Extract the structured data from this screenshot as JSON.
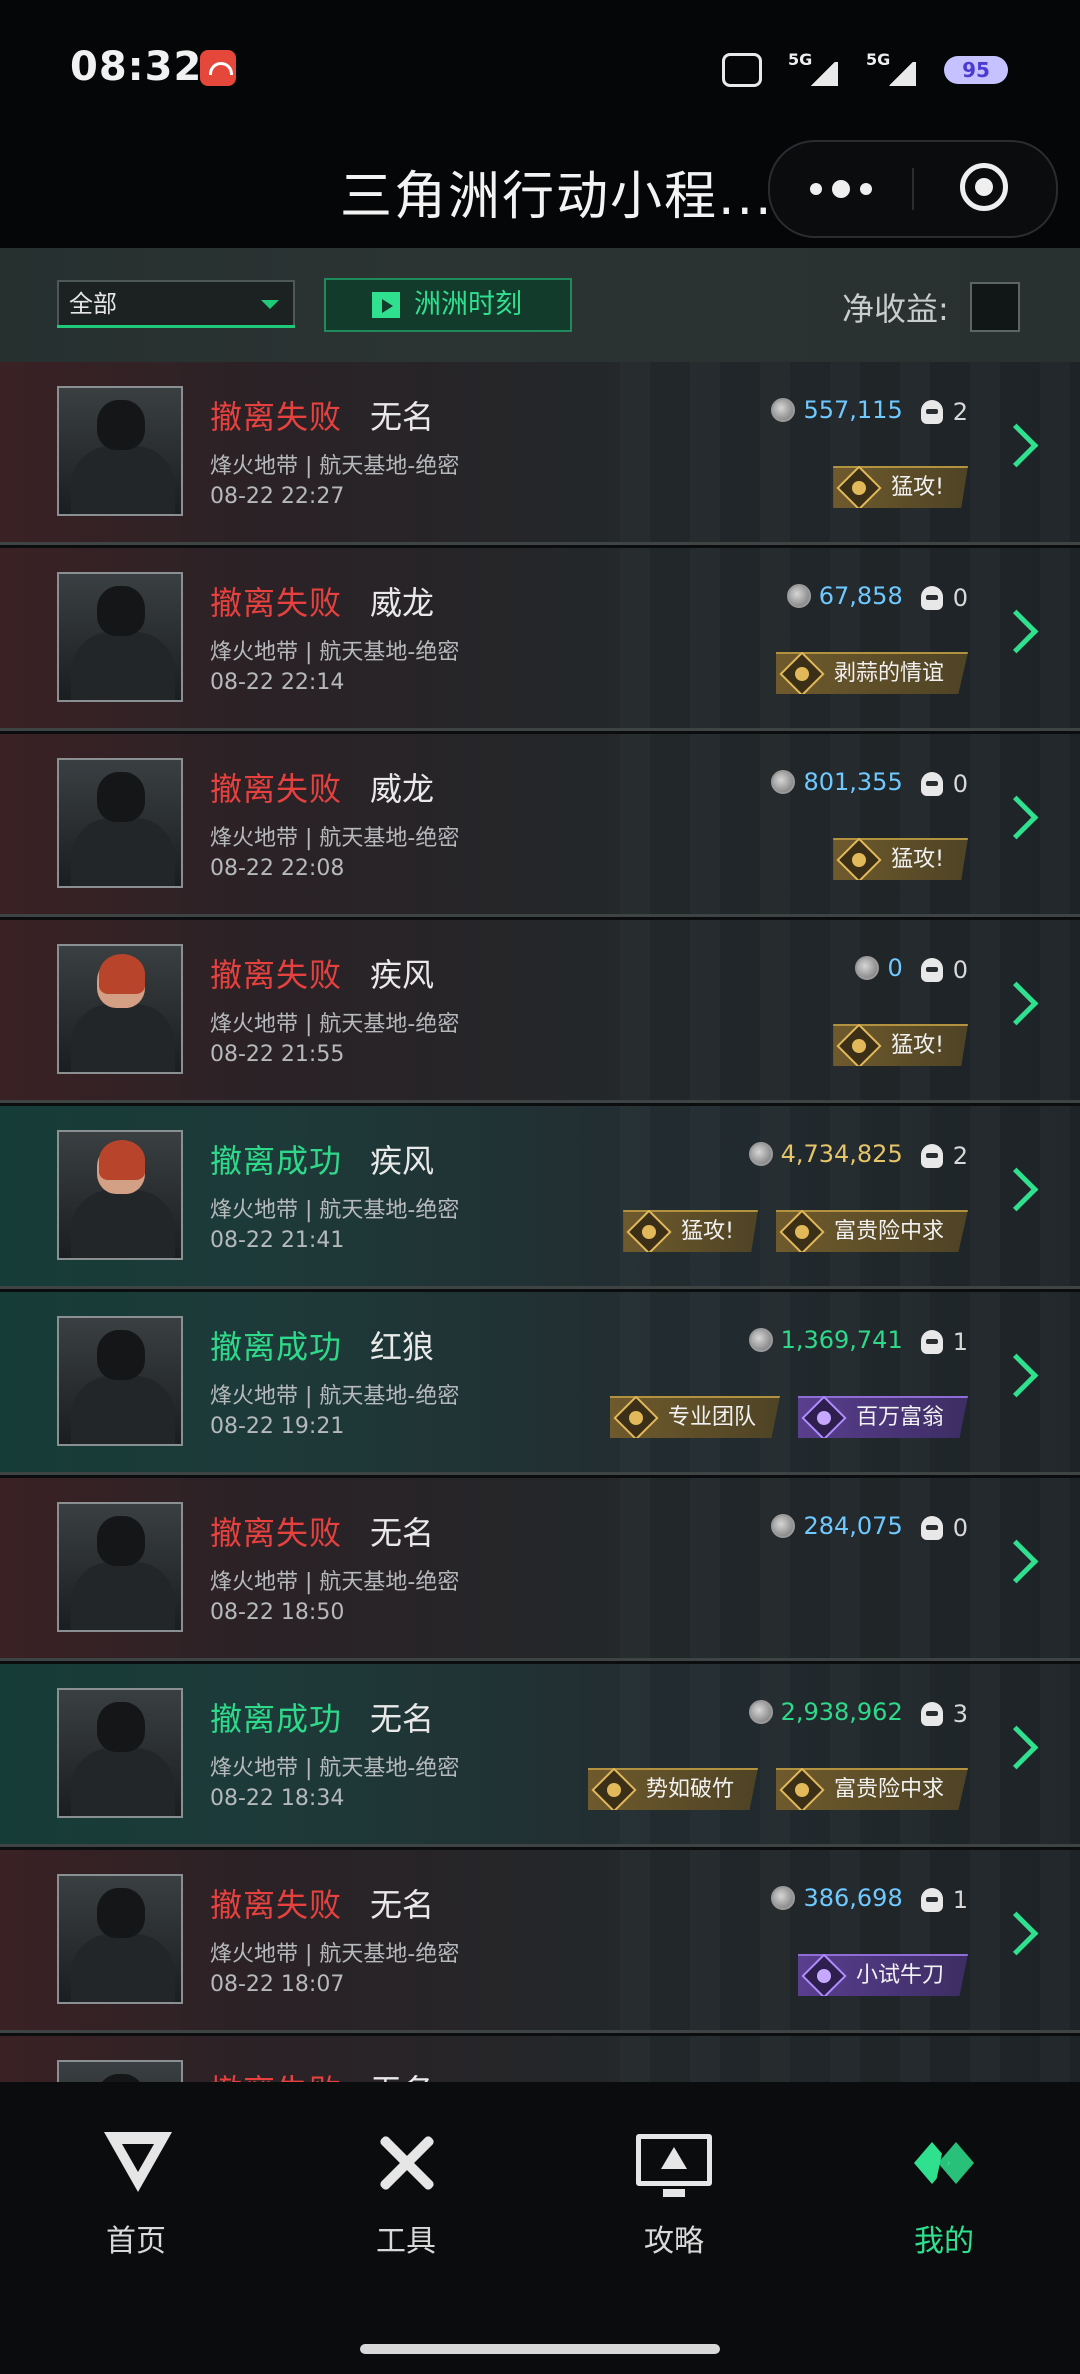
{
  "status_bar": {
    "time": "08:32",
    "network_1": "5G",
    "network_2": "5G",
    "battery": "95"
  },
  "header": {
    "title": "三角洲行动小程..."
  },
  "filter_bar": {
    "select_value": "全部",
    "moment_button": "洲洲时刻",
    "net_income_label": "净收益:"
  },
  "colors": {
    "accent_green": "#2fe08e",
    "fail_red": "#e6413f",
    "value_blue": "#6fc9ff",
    "value_gold": "#e6c46a"
  },
  "records": [
    {
      "status": "撤离失败",
      "result": "fail",
      "operator": "无名",
      "map": "烽火地带 | 航天基地-绝密",
      "datetime": "08-22 22:27",
      "value": "557,115",
      "kills": "2",
      "avatar": "masked-soldier",
      "badges": [
        {
          "label": "猛攻!",
          "tier": "gold"
        }
      ]
    },
    {
      "status": "撤离失败",
      "result": "fail",
      "operator": "威龙",
      "map": "烽火地带 | 航天基地-绝密",
      "datetime": "08-22 22:14",
      "value": "67,858",
      "kills": "0",
      "avatar": "armored-soldier",
      "badges": [
        {
          "label": "剥蒜的情谊",
          "tier": "gold"
        }
      ]
    },
    {
      "status": "撤离失败",
      "result": "fail",
      "operator": "威龙",
      "map": "烽火地带 | 航天基地-绝密",
      "datetime": "08-22 22:08",
      "value": "801,355",
      "kills": "0",
      "avatar": "armored-soldier",
      "badges": [
        {
          "label": "猛攻!",
          "tier": "gold"
        }
      ]
    },
    {
      "status": "撤离失败",
      "result": "fail",
      "operator": "疾风",
      "map": "烽火地带 | 航天基地-绝密",
      "datetime": "08-22 21:55",
      "value": "0",
      "kills": "0",
      "avatar": "red-hair-soldier",
      "badges": [
        {
          "label": "猛攻!",
          "tier": "gold"
        }
      ]
    },
    {
      "status": "撤离成功",
      "result": "succ",
      "operator": "疾风",
      "map": "烽火地带 | 航天基地-绝密",
      "datetime": "08-22 21:41",
      "value": "4,734,825",
      "value_color": "gold",
      "kills": "2",
      "avatar": "red-hair-soldier",
      "badges": [
        {
          "label": "猛攻!",
          "tier": "gold"
        },
        {
          "label": "富贵险中求",
          "tier": "gold"
        }
      ]
    },
    {
      "status": "撤离成功",
      "result": "succ",
      "operator": "红狼",
      "map": "烽火地带 | 航天基地-绝密",
      "datetime": "08-22 19:21",
      "value": "1,369,741",
      "value_color": "green",
      "kills": "1",
      "avatar": "helmet-soldier",
      "badges": [
        {
          "label": "专业团队",
          "tier": "gold"
        },
        {
          "label": "百万富翁",
          "tier": "purple"
        }
      ]
    },
    {
      "status": "撤离失败",
      "result": "fail",
      "operator": "无名",
      "map": "烽火地带 | 航天基地-绝密",
      "datetime": "08-22 18:50",
      "value": "284,075",
      "kills": "0",
      "avatar": "masked-soldier",
      "badges": []
    },
    {
      "status": "撤离成功",
      "result": "succ",
      "operator": "无名",
      "map": "烽火地带 | 航天基地-绝密",
      "datetime": "08-22 18:34",
      "value": "2,938,962",
      "value_color": "green",
      "kills": "3",
      "avatar": "masked-soldier",
      "badges": [
        {
          "label": "势如破竹",
          "tier": "gold"
        },
        {
          "label": "富贵险中求",
          "tier": "gold"
        }
      ]
    },
    {
      "status": "撤离失败",
      "result": "fail",
      "operator": "无名",
      "map": "烽火地带 | 航天基地-绝密",
      "datetime": "08-22 18:07",
      "value": "386,698",
      "kills": "1",
      "avatar": "masked-soldier",
      "badges": [
        {
          "label": "小试牛刀",
          "tier": "purple"
        }
      ]
    },
    {
      "status": "撤离失败",
      "result": "fail",
      "operator": "无名",
      "map": "",
      "datetime": "",
      "value": "",
      "kills": "",
      "avatar": "masked-soldier",
      "badges": []
    }
  ],
  "tabs": [
    {
      "label": "首页",
      "icon": "home-icon",
      "active": false
    },
    {
      "label": "工具",
      "icon": "tools-icon",
      "active": false
    },
    {
      "label": "攻略",
      "icon": "guide-icon",
      "active": false
    },
    {
      "label": "我的",
      "icon": "mine-icon",
      "active": true
    }
  ]
}
